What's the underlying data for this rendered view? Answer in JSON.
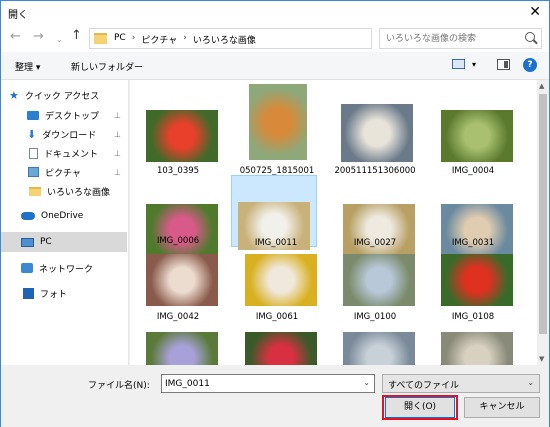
{
  "dialog": {
    "title": "開く",
    "close_glyph": "✕"
  },
  "nav": {
    "back": "←",
    "forward": "→",
    "recent": "⌄",
    "up": "↑",
    "breadcrumbs": [
      "PC",
      "ピクチャ",
      "いろいろな画像"
    ],
    "separator": "›",
    "refresh": "↻",
    "search_placeholder": "いろいろな画像の検索"
  },
  "toolbar": {
    "organize": "整理 ▾",
    "new_folder": "新しいフォルダー",
    "view_dd": "▾",
    "help": "?"
  },
  "sidebar": {
    "items": [
      {
        "label": "クイック アクセス",
        "icon": "star-icon"
      },
      {
        "label": "デスクトップ",
        "icon": "desktop-icon",
        "pin": "📌"
      },
      {
        "label": "ダウンロード",
        "icon": "download-icon",
        "pin": "📌"
      },
      {
        "label": "ドキュメント",
        "icon": "document-icon",
        "pin": "📌"
      },
      {
        "label": "ピクチャ",
        "icon": "pictures-icon",
        "pin": "📌"
      },
      {
        "label": "いろいろな画像",
        "icon": "folder-icon"
      },
      {
        "label": "OneDrive",
        "icon": "onedrive-icon"
      },
      {
        "label": "PC",
        "icon": "pc-icon"
      },
      {
        "label": "ネットワーク",
        "icon": "network-icon"
      },
      {
        "label": "フォト",
        "icon": "photos-icon"
      }
    ]
  },
  "files": [
    {
      "name": "103_0395",
      "colors": [
        "#3f6a2a",
        "#e8402a"
      ]
    },
    {
      "name": "050725_1815001",
      "colors": [
        "#8ea87a",
        "#d88a3a"
      ]
    },
    {
      "name": "200511151306000",
      "colors": [
        "#6b7a8a",
        "#e8e4da"
      ]
    },
    {
      "name": "IMG_0004",
      "colors": [
        "#5c7a2e",
        "#a8c070"
      ]
    },
    {
      "name": "IMG_0006",
      "colors": [
        "#4f7a2c",
        "#d85a8a"
      ]
    },
    {
      "name": "IMG_0011",
      "colors": [
        "#c9b27a",
        "#f2f0ea"
      ]
    },
    {
      "name": "IMG_0027",
      "colors": [
        "#b8a064",
        "#eeeae0"
      ]
    },
    {
      "name": "IMG_0031",
      "colors": [
        "#6a8aa0",
        "#e0ccb0"
      ]
    },
    {
      "name": "IMG_0042",
      "colors": [
        "#8a5a4a",
        "#ecdcd0"
      ]
    },
    {
      "name": "IMG_0061",
      "colors": [
        "#d8b020",
        "#f0e8dc"
      ]
    },
    {
      "name": "IMG_0100",
      "colors": [
        "#7a8a6a",
        "#b8c8d8"
      ]
    },
    {
      "name": "IMG_0108",
      "colors": [
        "#3a6a2a",
        "#e03020"
      ]
    },
    {
      "name": "",
      "colors": [
        "#5a7a3a",
        "#a8a0d8"
      ]
    },
    {
      "name": "",
      "colors": [
        "#3a5a2a",
        "#d83040"
      ]
    },
    {
      "name": "",
      "colors": [
        "#7a8a9a",
        "#c8d0d8"
      ]
    },
    {
      "name": "",
      "colors": [
        "#8a8a7a",
        "#d8d0c0"
      ]
    }
  ],
  "bottom": {
    "filename_label": "ファイル名(N):",
    "filename_value": "IMG_0011",
    "dd_glyph": "⌄",
    "filetype": "すべてのファイル",
    "open_label": "開く(O)",
    "cancel_label": "キャンセル"
  },
  "colors": {
    "accent": "#0078d7",
    "selected_tile": "#cce8ff",
    "highlight": "#e81123"
  }
}
